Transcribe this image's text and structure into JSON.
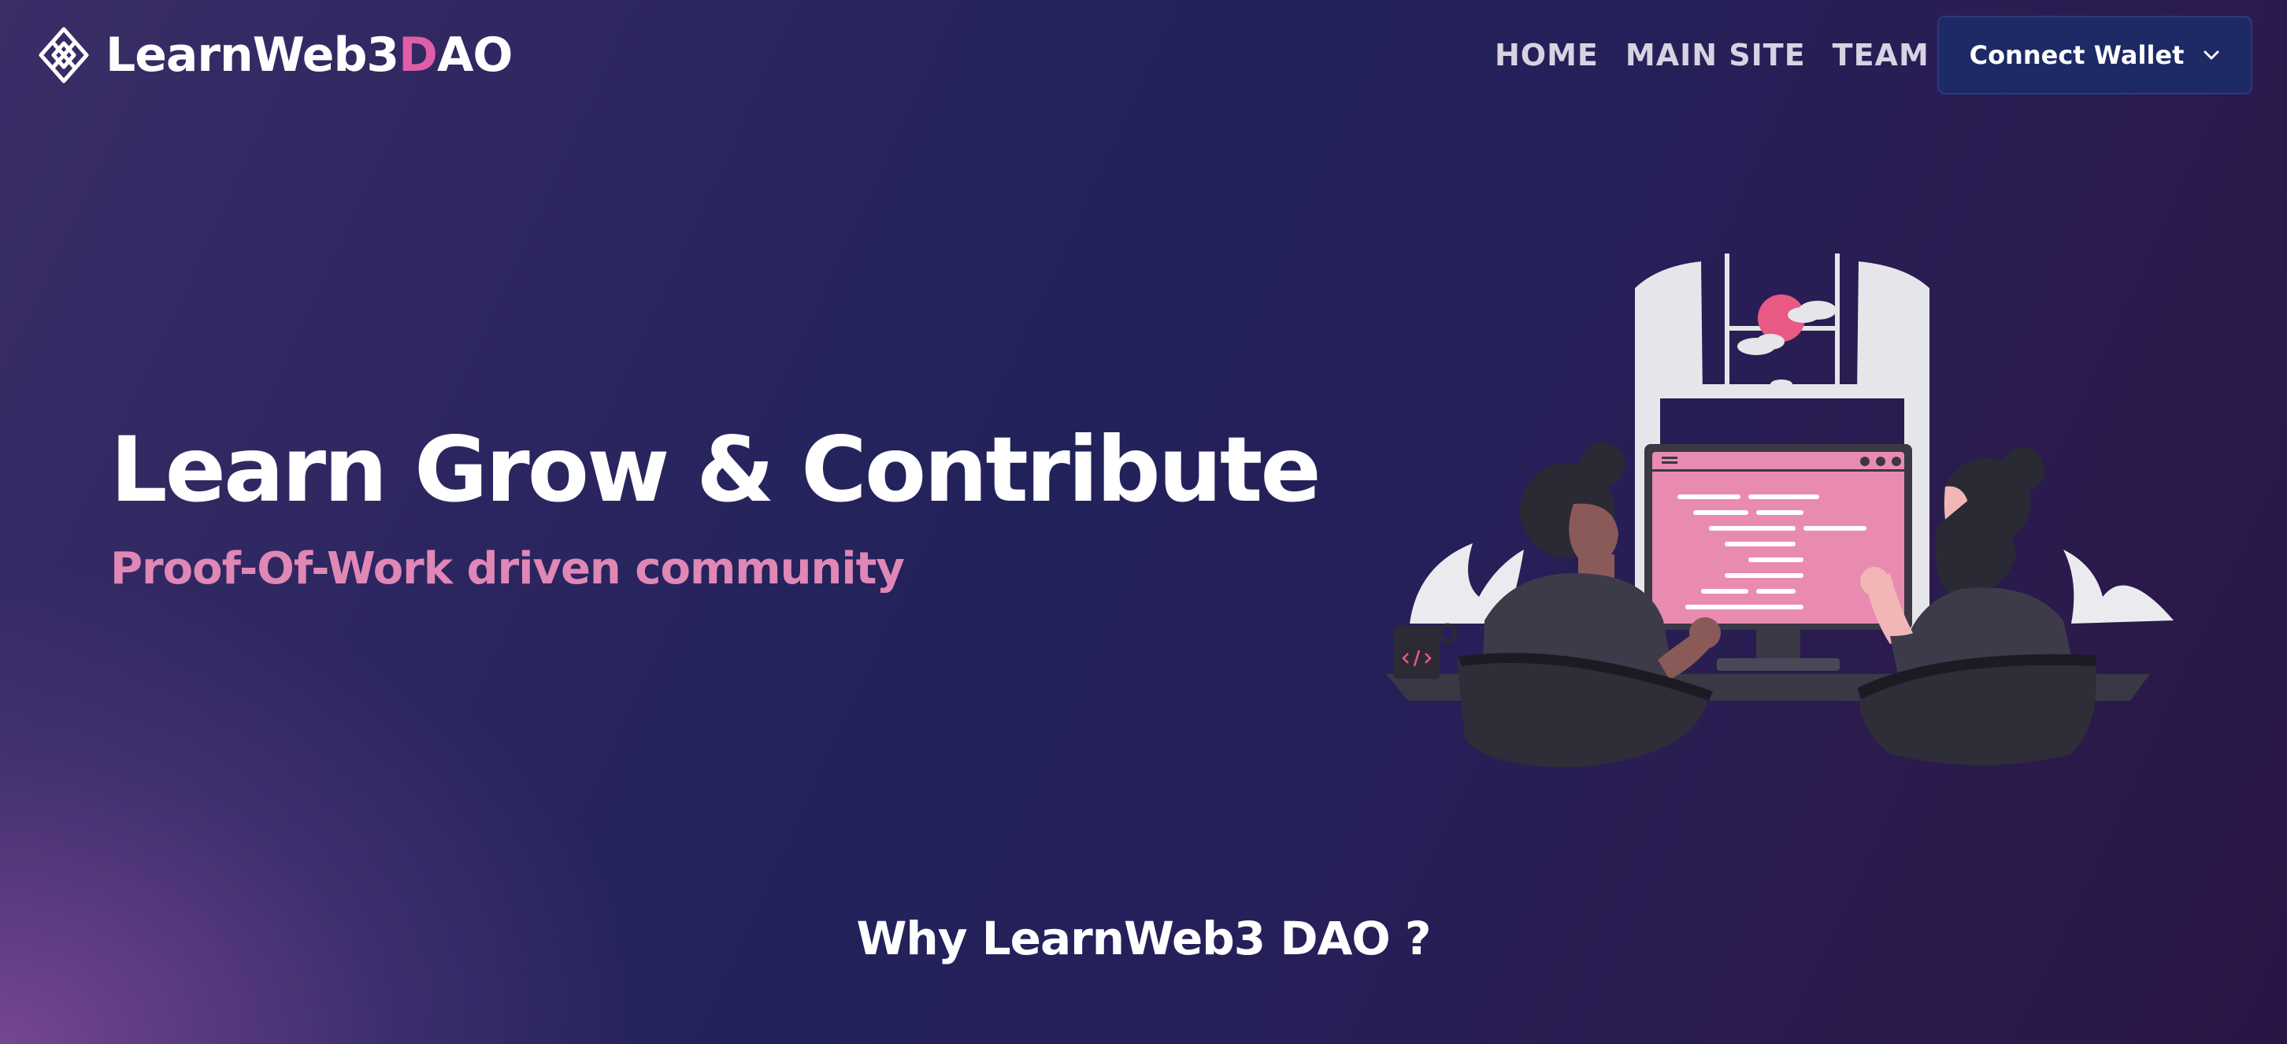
{
  "header": {
    "logo": {
      "icon": "learnweb3-diamond-logo-icon",
      "text_before_accent": "LearnWeb3",
      "text_accent": "D",
      "text_after_accent": "AO"
    },
    "nav": {
      "home": "HOME",
      "main_site": "MAIN SITE",
      "team": "TEAM"
    },
    "connect_wallet": {
      "label": "Connect Wallet",
      "icon": "chevron-down-icon"
    }
  },
  "hero": {
    "title": "Learn Grow & Contribute",
    "subtitle": "Proof-Of-Work driven community",
    "illustration": "two-developers-at-computer-illustration"
  },
  "section": {
    "heading": "Why LearnWeb3 DAO ?"
  },
  "colors": {
    "accent_pink": "#e05ea8",
    "subtitle_pink": "#e087b6",
    "button_bg": "#1e2a66",
    "background_dark": "#22225a",
    "background_glow": "#8c50a0"
  }
}
